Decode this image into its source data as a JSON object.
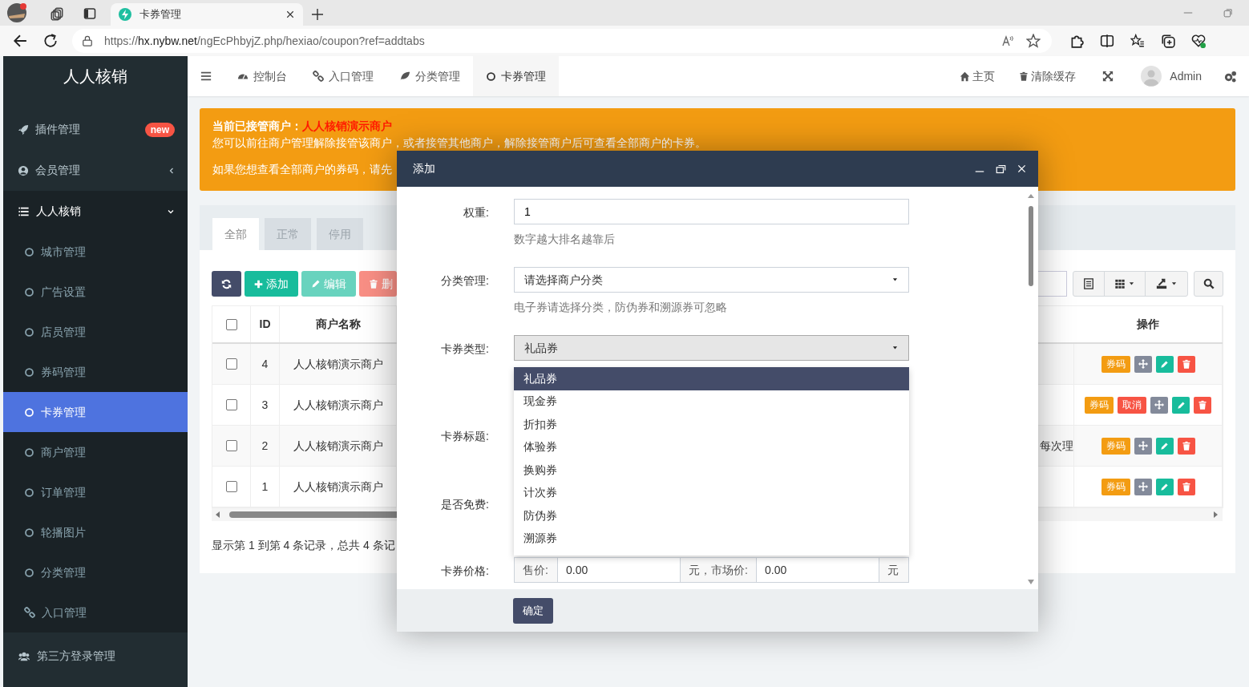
{
  "browser": {
    "tabs": [
      {
        "title": "卡券管理",
        "selected": true
      }
    ],
    "url": "https://**hx.nybw.net**/ngEcPhbyjZ.php/hexiao/coupon?ref=addtabs"
  },
  "sidebar": {
    "logo": "人人核销",
    "items": [
      {
        "label": "插件管理",
        "badge": "new"
      },
      {
        "label": "会员管理",
        "expanded": false
      },
      {
        "label": "人人核销",
        "expanded": true,
        "children": [
          {
            "label": "城市管理",
            "selected": false
          },
          {
            "label": "广告设置",
            "selected": false
          },
          {
            "label": "店员管理",
            "selected": false
          },
          {
            "label": "券码管理",
            "selected": false
          },
          {
            "label": "卡券管理",
            "selected": true
          },
          {
            "label": "商户管理",
            "selected": false
          },
          {
            "label": "订单管理",
            "selected": false
          },
          {
            "label": "轮播图片",
            "selected": false
          },
          {
            "label": "分类管理",
            "selected": false
          },
          {
            "label": "入口管理",
            "selected": false
          }
        ]
      },
      {
        "label": "第三方登录管理"
      }
    ]
  },
  "topnav": {
    "tabs": [
      {
        "label": "控制台",
        "selected": false
      },
      {
        "label": "入口管理",
        "selected": false
      },
      {
        "label": "分类管理",
        "selected": false
      },
      {
        "label": "卡券管理",
        "selected": true
      }
    ],
    "links": [
      "主页",
      "清除缓存"
    ],
    "user": "Admin"
  },
  "alert": {
    "label": "当前已接管商户：",
    "merchant": "人人核销演示商户",
    "lines": [
      "您可以前往商户管理解除接管该商户，或者接管其他商户，解除接管商户后可查看全部商户的卡券。",
      "如果您想查看全部商户的券码，请先"
    ]
  },
  "filter_tabs": [
    {
      "label": "全部",
      "selected": true
    },
    {
      "label": "正常",
      "selected": false
    },
    {
      "label": "停用",
      "selected": false
    }
  ],
  "toolbar": {
    "buttons": [
      {
        "label": "添加",
        "disabled": false
      },
      {
        "label": "编辑",
        "disabled": true
      },
      {
        "label": "删",
        "disabled": true
      }
    ]
  },
  "table": {
    "header_checked": false,
    "columns": [
      "ID",
      "商户名称",
      "操作"
    ],
    "rows": [
      {
        "checked": false,
        "id": "4",
        "merchant": "人人核销演示商户",
        "actions": [
          {
            "label": "券码",
            "color": "#f39c12"
          }
        ]
      },
      {
        "checked": false,
        "id": "3",
        "merchant": "人人核销演示商户",
        "actions": [
          {
            "label": "券码",
            "color": "#f39c12"
          },
          {
            "label": "取消",
            "color": "#f75444"
          }
        ]
      },
      {
        "checked": false,
        "id": "2",
        "merchant": "人人核销演示商户",
        "column_4": "每次理",
        "actions": [
          {
            "label": "券码",
            "color": "#f39c12"
          }
        ]
      },
      {
        "checked": false,
        "id": "1",
        "merchant": "人人核销演示商户",
        "actions": [
          {
            "label": "券码",
            "color": "#f39c12"
          }
        ]
      }
    ]
  },
  "pagination": {
    "summary": "显示第 1 到第 4 条记录，总共 4 条记"
  },
  "modal": {
    "title": "添加",
    "fields": [
      {
        "kind": "input",
        "label": "权重:",
        "value": "1",
        "help": "数字越大排名越靠后"
      },
      {
        "kind": "select",
        "label": "分类管理:",
        "placeholder": "请选择商户分类",
        "help": "电子券请选择分类，防伪券和溯源券可忽略"
      },
      {
        "kind": "select",
        "label": "卡券类型:",
        "value": "礼品券",
        "open": true,
        "options": [
          {
            "label": "礼品券",
            "selected": true
          },
          {
            "label": "现金券",
            "selected": false
          },
          {
            "label": "折扣券",
            "selected": false
          },
          {
            "label": "体验券",
            "selected": false
          },
          {
            "label": "换购券",
            "selected": false
          },
          {
            "label": "计次券",
            "selected": false
          },
          {
            "label": "防伪券",
            "selected": false
          },
          {
            "label": "溯源券",
            "selected": false
          }
        ]
      },
      {
        "kind": "covered",
        "label": "卡券标题:"
      },
      {
        "kind": "covered",
        "label": "是否免费:"
      },
      {
        "kind": "price",
        "label": "卡券价格:",
        "prefix": "售价:",
        "value": "0.00",
        "middle": "元，市场价:",
        "value2": "0.00",
        "suffix": "元"
      }
    ],
    "submit": "确定"
  }
}
